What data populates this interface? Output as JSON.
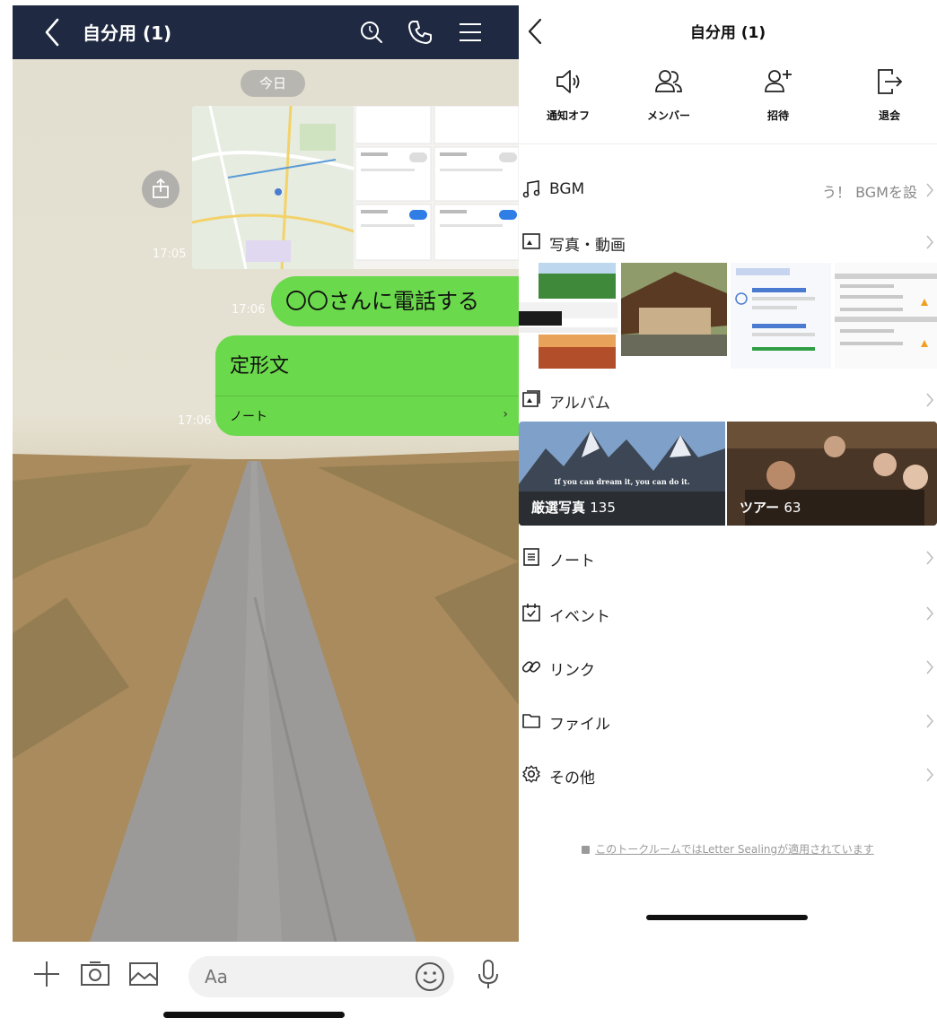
{
  "chat": {
    "header": {
      "title": "自分用 (1)"
    },
    "date_badge": "今日",
    "messages": [
      {
        "type": "image",
        "time": "17:05"
      },
      {
        "type": "text",
        "text": "〇〇さんに電話する",
        "time": "17:06"
      },
      {
        "type": "note",
        "text": "定形文",
        "footer": "ノート",
        "time": "17:06"
      }
    ],
    "input": {
      "placeholder": "Aa"
    }
  },
  "menu": {
    "header": {
      "title": "自分用 (1)"
    },
    "actions": [
      {
        "label": "通知オフ",
        "icon": "speaker-icon"
      },
      {
        "label": "メンバー",
        "icon": "members-icon"
      },
      {
        "label": "招待",
        "icon": "add-user-icon"
      },
      {
        "label": "退会",
        "icon": "leave-icon"
      }
    ],
    "rows": {
      "bgm": {
        "label": "BGM",
        "value": "う！ BGMを設",
        "icon": "music-note-icon"
      },
      "photos": {
        "label": "写真・動画",
        "icon": "photo-icon"
      },
      "album": {
        "label": "アルバム",
        "icon": "album-icon"
      },
      "note": {
        "label": "ノート",
        "icon": "note-icon"
      },
      "event": {
        "label": "イベント",
        "icon": "calendar-check-icon"
      },
      "link": {
        "label": "リンク",
        "icon": "link-icon"
      },
      "file": {
        "label": "ファイル",
        "icon": "folder-icon"
      },
      "other": {
        "label": "その他",
        "icon": "gear-icon"
      }
    },
    "albums": [
      {
        "name": "厳選写真",
        "count": "135",
        "quote": "If you can dream it, you can do it."
      },
      {
        "name": "ツアー",
        "count": "63"
      }
    ],
    "sealing_text": "このトークルームではLetter Sealingが適用されています"
  },
  "colors": {
    "header_bg": "#1f2a42",
    "bubble_green": "#6ad94b"
  }
}
